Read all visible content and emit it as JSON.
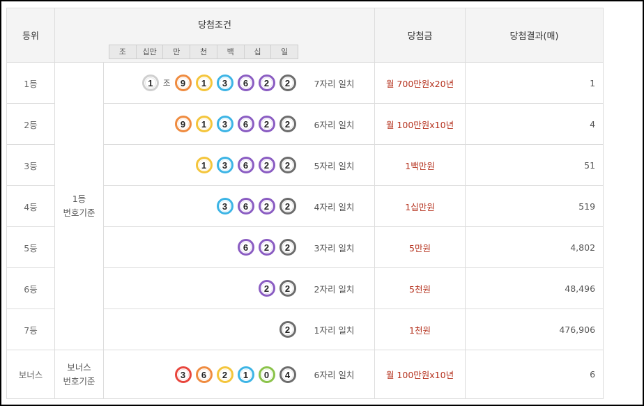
{
  "headers": {
    "rank": "등위",
    "condition": "당첨조건",
    "prize": "당첨금",
    "result": "당첨결과(매)",
    "positions": [
      "조",
      "십만",
      "만",
      "천",
      "백",
      "십",
      "일"
    ]
  },
  "ball_colors": {
    "1": "#f0f0f0",
    "9": "#e8453c",
    "1b": "#ef8b3f",
    "3": "#f4c53b",
    "6": "#3cb4e5",
    "2": "#8a5cc2",
    "2last": "#6c6c6c",
    "0": "#8bc34a",
    "4": "#6c6c6c"
  },
  "jo_label": "조",
  "basis_first": "1등\n번호기준",
  "basis_first_line1": "1등",
  "basis_first_line2": "번호기준",
  "basis_bonus_line1": "보너스",
  "basis_bonus_line2": "번호기준",
  "rows": [
    {
      "rank": "1등",
      "jo": "1",
      "balls": [
        "9",
        "1",
        "3",
        "6",
        "2",
        "2"
      ],
      "match": "7자리 일치",
      "prize": "월 700만원x20년",
      "count": "1"
    },
    {
      "rank": "2등",
      "balls": [
        "9",
        "1",
        "3",
        "6",
        "2",
        "2"
      ],
      "match": "6자리 일치",
      "prize": "월 100만원x10년",
      "count": "4"
    },
    {
      "rank": "3등",
      "balls": [
        "1",
        "3",
        "6",
        "2",
        "2"
      ],
      "match": "5자리 일치",
      "prize": "1백만원",
      "count": "51"
    },
    {
      "rank": "4등",
      "balls": [
        "3",
        "6",
        "2",
        "2"
      ],
      "match": "4자리 일치",
      "prize": "1십만원",
      "count": "519"
    },
    {
      "rank": "5등",
      "balls": [
        "6",
        "2",
        "2"
      ],
      "match": "3자리 일치",
      "prize": "5만원",
      "count": "4,802"
    },
    {
      "rank": "6등",
      "balls": [
        "2",
        "2"
      ],
      "match": "2자리 일치",
      "prize": "5천원",
      "count": "48,496"
    },
    {
      "rank": "7등",
      "balls": [
        "2"
      ],
      "match": "1자리 일치",
      "prize": "1천원",
      "count": "476,906"
    },
    {
      "rank": "보너스",
      "balls": [
        "3",
        "6",
        "2",
        "1",
        "0",
        "4"
      ],
      "match": "6자리 일치",
      "prize": "월 100만원x10년",
      "count": "6"
    }
  ]
}
